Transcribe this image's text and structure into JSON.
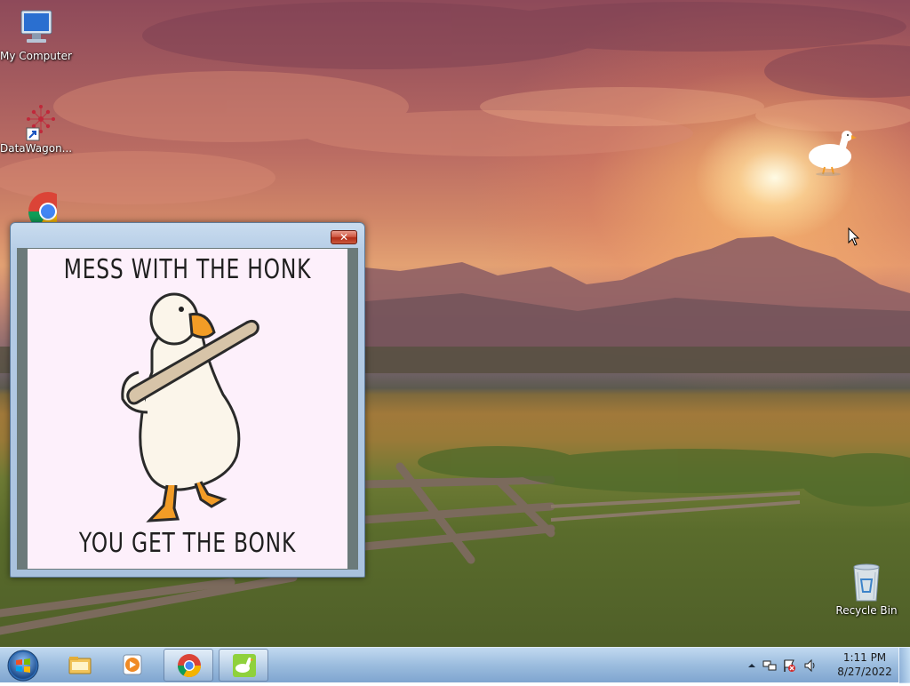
{
  "desktop": {
    "icons": [
      {
        "label": "My Computer",
        "icon": "computer-icon"
      },
      {
        "label": "DataWagon...",
        "icon": "datawagon-shortcut-icon"
      },
      {
        "label": "",
        "icon": "chrome-icon"
      },
      {
        "label": "Recycle Bin",
        "icon": "recycle-bin-icon"
      }
    ]
  },
  "popup": {
    "close_label": "✕",
    "meme_top": "MESS WITH THE HONK",
    "meme_bottom": "YOU GET THE BONK"
  },
  "taskbar": {
    "start_icon": "windows-start-icon",
    "pinned": [
      {
        "icon": "file-explorer-icon",
        "active": false
      },
      {
        "icon": "media-player-icon",
        "active": false
      },
      {
        "icon": "chrome-icon",
        "active": true
      },
      {
        "icon": "goose-app-icon",
        "active": true
      }
    ],
    "tray": {
      "icons": [
        "show-hidden-icons-arrow",
        "network-icon",
        "action-center-flag-icon",
        "volume-icon"
      ],
      "time": "1:11 PM",
      "date": "8/27/2022"
    }
  },
  "colors": {
    "sky_top": "#8e4a5a",
    "sunset_orange": "#e3a173",
    "grass": "#6d7a34",
    "taskbar_blue": "#96b9dc",
    "close_red": "#c8402a",
    "meme_bg": "#fdf0fb",
    "goose_orange": "#f29c26"
  }
}
